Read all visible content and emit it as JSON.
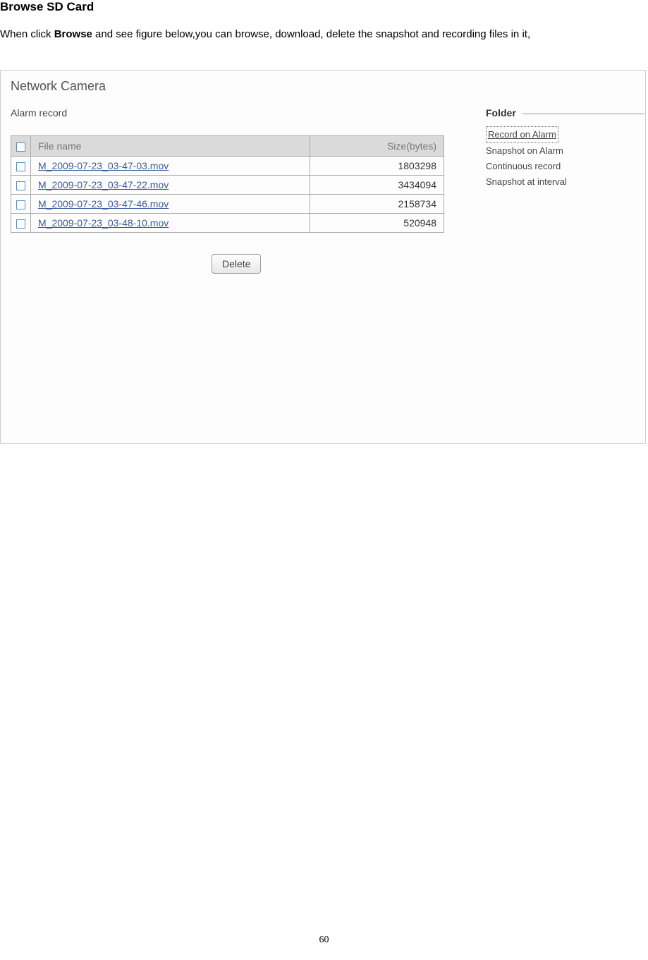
{
  "page": {
    "title": "Browse SD Card",
    "intro": {
      "prefix": "When click ",
      "bold": "Browse",
      "suffix": " and see figure below,you can browse, download, delete the snapshot and recording files in it,"
    },
    "number": "60"
  },
  "app": {
    "title": "Network Camera",
    "section_heading": "Alarm record",
    "table": {
      "headers": {
        "filename": "File name",
        "size": "Size(bytes)"
      },
      "rows": [
        {
          "filename": "M_2009-07-23_03-47-03.mov",
          "size": "1803298"
        },
        {
          "filename": "M_2009-07-23_03-47-22.mov",
          "size": "3434094"
        },
        {
          "filename": "M_2009-07-23_03-47-46.mov",
          "size": "2158734"
        },
        {
          "filename": "M_2009-07-23_03-48-10.mov",
          "size": "520948"
        }
      ]
    },
    "delete_label": "Delete",
    "side": {
      "title": "Folder",
      "items": [
        {
          "label": "Record on Alarm",
          "selected": true
        },
        {
          "label": "Snapshot on Alarm",
          "selected": false
        },
        {
          "label": "Continuous record",
          "selected": false
        },
        {
          "label": "Snapshot at interval",
          "selected": false
        }
      ]
    }
  }
}
